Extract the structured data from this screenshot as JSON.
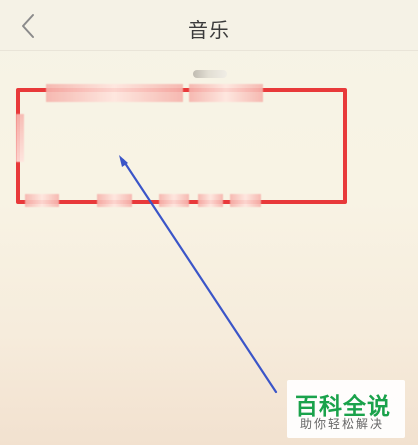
{
  "header": {
    "title": "音乐",
    "back_icon": "chevron-left-icon"
  },
  "annotation": {
    "highlight_color": "#e8393a",
    "arrow_color": "#3b55c8"
  },
  "watermark": {
    "main": "百科全说",
    "sub": "助你轻松解决"
  }
}
